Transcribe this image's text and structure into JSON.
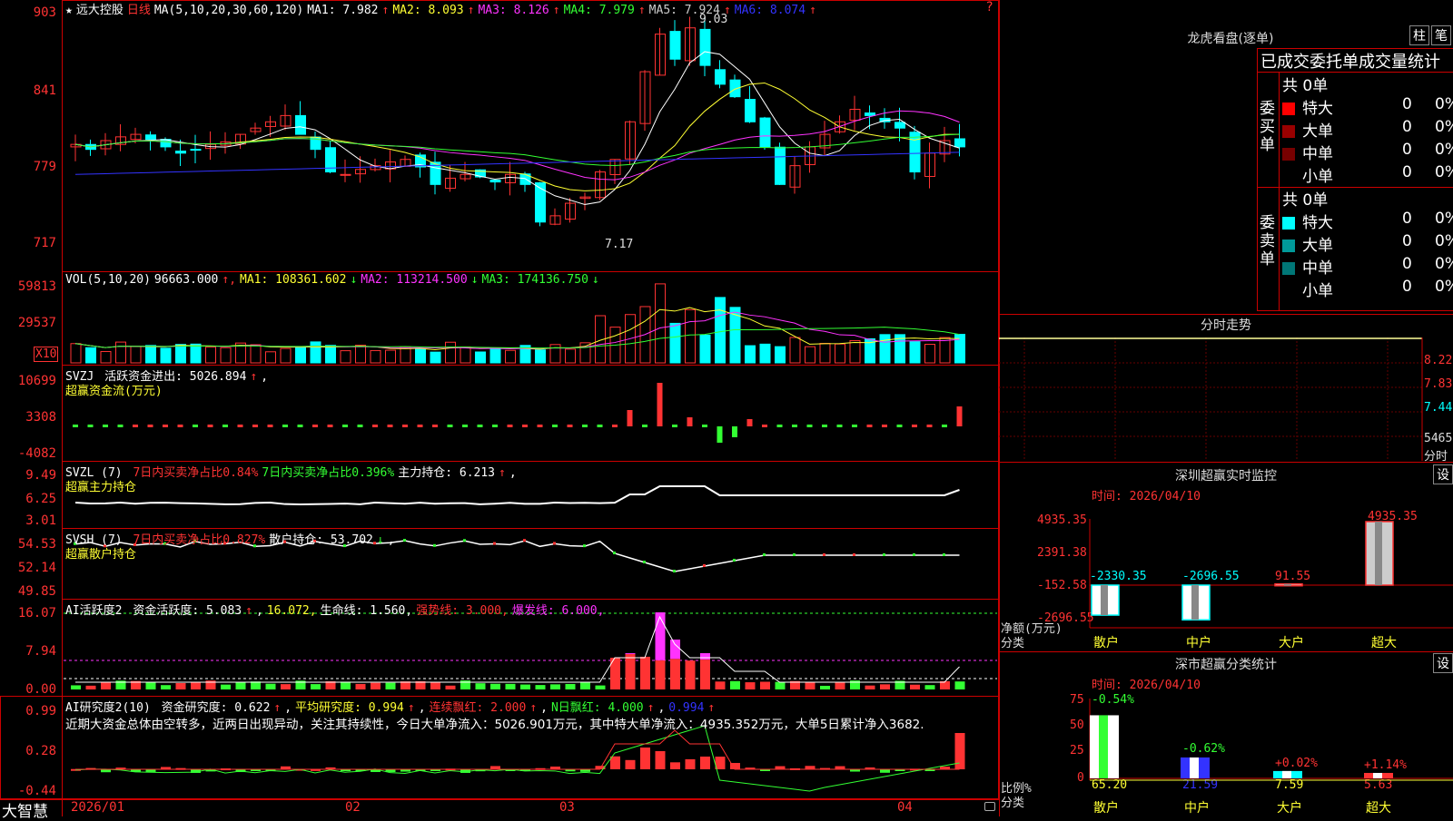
{
  "stock": {
    "star": "★",
    "name": "远大控股",
    "period": "日线"
  },
  "kline": {
    "ma_label": "MA(5,10,20,30,60,120)",
    "ma": [
      {
        "label": "MA1: 7.982",
        "color": "#ffffff"
      },
      {
        "label": "MA2: 8.093",
        "color": "#ffff33"
      },
      {
        "label": "MA3: 8.126",
        "color": "#ff33ff"
      },
      {
        "label": "MA4: 7.979",
        "color": "#33ff33"
      },
      {
        "label": "MA5: 7.924",
        "color": "#cccccc"
      },
      {
        "label": "MA6: 8.074",
        "color": "#3333ff"
      }
    ],
    "arrow": "↑",
    "y_ticks": [
      "903",
      "841",
      "779",
      "717"
    ],
    "high_mark": "9.03",
    "low_mark": "7.17"
  },
  "vol": {
    "label": "VOL(5,10,20)",
    "value": "96663.000",
    "ma": [
      {
        "label": "MA1: 108361.602",
        "arrow": "↓",
        "color": "#ffff33"
      },
      {
        "label": "MA2: 113214.500",
        "arrow": "↓",
        "color": "#ff33ff"
      },
      {
        "label": "MA3: 174136.750",
        "arrow": "↓",
        "color": "#33ff33"
      }
    ],
    "y_ticks": [
      "59813",
      "29537"
    ],
    "unit": "X10"
  },
  "svzj": {
    "label": "SVZJ",
    "text": "活跃资金进出: 5026.894",
    "sub": "超赢资金流(万元)",
    "y_ticks": [
      "10699",
      "3308",
      "-4082"
    ]
  },
  "svzl": {
    "label": "SVZL (7)",
    "t1": "7日内买卖净占比0.84%",
    "t2": "7日内买卖净占比0.396%",
    "t3": "主力持仓: 6.213",
    "sub": "超赢主力持仓",
    "y_ticks": [
      "9.49",
      "6.25",
      "3.01"
    ]
  },
  "svsh": {
    "label": "SVSH (7)",
    "t1": "7日内买卖净占比0.827%",
    "t2": "散户持仓: 53.702",
    "sub": "超赢散户持仓",
    "y_ticks": [
      "54.53",
      "52.14",
      "49.85"
    ]
  },
  "ai1": {
    "label": "AI活跃度2",
    "t1": "资金活跃度: 5.083",
    "t2": "16.072,",
    "t3": "生命线: 1.560,",
    "t4": "强势线: 3.000,",
    "t5": "爆发线: 6.000,",
    "y_ticks": [
      "16.07",
      "7.94",
      "0.00"
    ]
  },
  "ai2": {
    "label": "AI研究度2(10)",
    "t1": "资金研究度: 0.622",
    "t2": "平均研究度: 0.994",
    "t3": "连续飘红: 2.000",
    "t4": "N日飘红: 4.000",
    "t5": "0.994",
    "note": "近期大资金总体由空转多，近两日出现异动，关注其持续性，今日大单净流入：5026.901万元，其中特大单净流入：4935.352万元，大单5日累计净入3682.",
    "y_ticks": [
      "0.99",
      "0.28",
      "-0.44"
    ]
  },
  "xaxis": {
    "brand": "大智慧",
    "labels": [
      "2026/01",
      "02",
      "03",
      "04"
    ]
  },
  "right": {
    "btn1": "柱",
    "btn2": "笔",
    "dragon_title": "龙虎看盘(逐单)",
    "stat_title": "已成交委托单成交量统计",
    "buy_label": "委买单",
    "sell_label": "委卖单",
    "total": "共 0单",
    "rows": [
      {
        "name": "特大",
        "count": "0",
        "pct": "0%"
      },
      {
        "name": "大单",
        "count": "0",
        "pct": "0%"
      },
      {
        "name": "中单",
        "count": "0",
        "pct": "0%"
      },
      {
        "name": "小单",
        "count": "0",
        "pct": "0%"
      }
    ],
    "fenshi_title": "分时走势",
    "fenshi_ticks": [
      "8.22",
      "7.83",
      "7.44",
      "5465"
    ],
    "fenshi_unit": "分时",
    "sz_title": "深圳超赢实时监控",
    "sz_btn": "设",
    "sz_time": "时间: 2026/04/10",
    "sz_ticks": [
      "4935.35",
      "2391.38",
      "-152.58",
      "-2696.55"
    ],
    "sz_ylabel": "净额(万元)",
    "sz_xlabel": "分类",
    "cat_names": [
      "散户",
      "中户",
      "大户",
      "超大"
    ],
    "sz_values": [
      "-2330.35",
      "-2696.55",
      "91.55",
      "4935.35"
    ],
    "cls_title": "深市超赢分类统计",
    "cls_btn": "设",
    "cls_time": "时间: 2026/04/10",
    "cls_ticks": [
      "75",
      "50",
      "25",
      "0"
    ],
    "cls_ylabel": "比例%",
    "cls_xlabel": "分类",
    "cls_pcts": [
      "-0.54%",
      "-0.62%",
      "+0.02%",
      "+1.14%"
    ],
    "cls_values": [
      "65.20",
      "21.59",
      "7.59",
      "5.63"
    ]
  }
}
